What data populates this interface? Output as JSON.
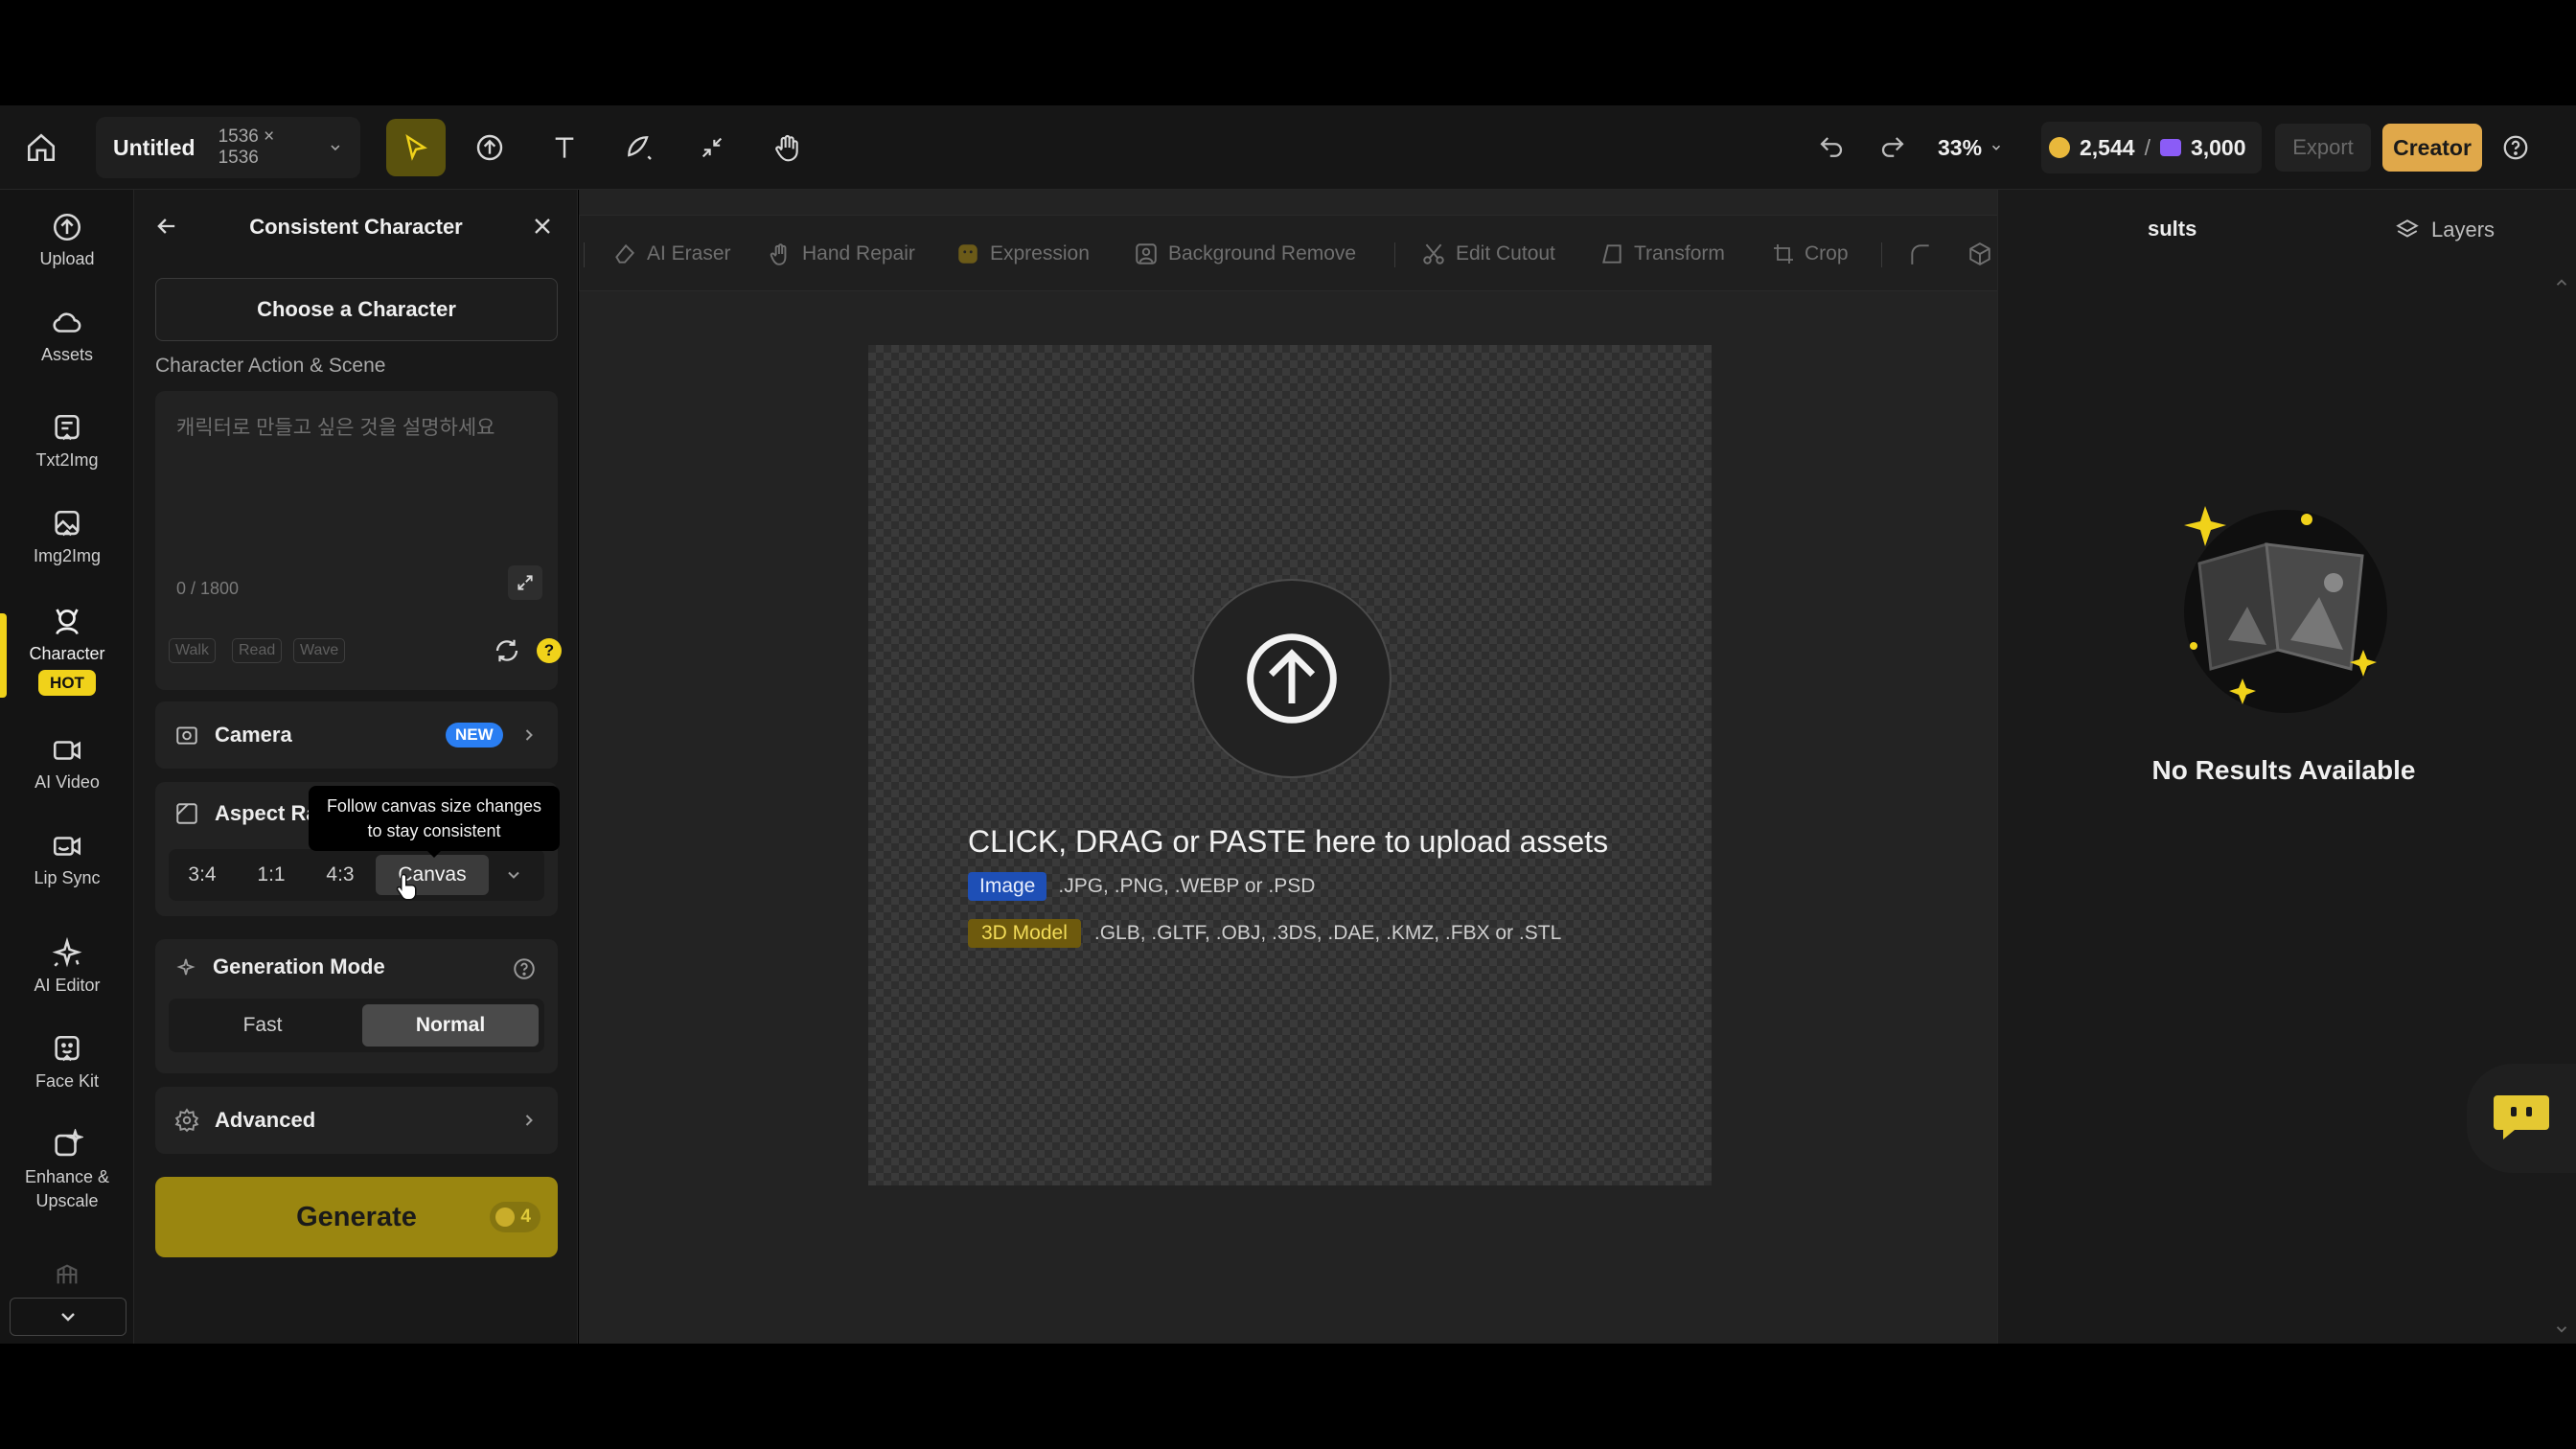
{
  "topbar": {
    "project_name": "Untitled",
    "canvas_size": "1536 × 1536",
    "zoom": "33%",
    "credits": "2,544",
    "credits_separator": "/",
    "premium_credits": "3,000",
    "export_label": "Export",
    "plan_label": "Creator",
    "tools": [
      "select-tool",
      "upload-tool",
      "text-tool",
      "shape-tool",
      "compress-tool",
      "hand-tool"
    ],
    "active_tool": "select-tool"
  },
  "rail": {
    "items": [
      {
        "label": "Upload",
        "icon": "upload-icon"
      },
      {
        "label": "Assets",
        "icon": "cloud-icon"
      },
      {
        "label": "Txt2Img",
        "icon": "txt2img-icon"
      },
      {
        "label": "Img2Img",
        "icon": "img2img-icon"
      },
      {
        "label": "Character",
        "icon": "character-icon",
        "badge": "HOT"
      },
      {
        "label": "AI Video",
        "icon": "video-icon"
      },
      {
        "label": "Lip Sync",
        "icon": "lip-sync-icon"
      },
      {
        "label": "AI Editor",
        "icon": "sparkle-icon"
      },
      {
        "label": "Face Kit",
        "icon": "face-kit-icon"
      },
      {
        "label": "Enhance &",
        "label2": "Upscale",
        "icon": "enhance-icon"
      }
    ],
    "active_item": "Character"
  },
  "panel": {
    "title": "Consistent Character",
    "choose_label": "Choose a Character",
    "scene_label": "Character Action & Scene",
    "scene_placeholder": "캐릭터로 만들고 싶은 것을 설명하세요",
    "scene_count": "0 / 1800",
    "chips": [
      "Walk",
      "Read",
      "Wave"
    ],
    "camera_label": "Camera",
    "camera_badge": "NEW",
    "aspect_label": "Aspect Ra",
    "aspect_options": [
      "3:4",
      "1:1",
      "4:3",
      "Canvas"
    ],
    "aspect_selected": "Canvas",
    "tooltip_line1": "Follow canvas size changes",
    "tooltip_line2": "to stay consistent",
    "mode_label": "Generation Mode",
    "mode_options": [
      "Fast",
      "Normal"
    ],
    "mode_selected": "Normal",
    "advanced_label": "Advanced",
    "generate_label": "Generate",
    "generate_cost": "4"
  },
  "canvas_toolbar": {
    "items": [
      "AI Eraser",
      "Hand Repair",
      "Expression",
      "Background Remove",
      "Edit Cutout",
      "Transform",
      "Crop"
    ]
  },
  "canvas": {
    "upload_title": "CLICK, DRAG or PASTE here to upload assets",
    "image_tag": "Image",
    "image_formats": ".JPG, .PNG, .WEBP or .PSD",
    "model_tag": "3D Model",
    "model_formats": ".GLB, .GLTF, .OBJ, .3DS, .DAE, .KMZ, .FBX or .STL"
  },
  "results": {
    "tab_results": "sults",
    "tab_layers": "Layers",
    "empty_text": "No Results Available"
  },
  "colors": {
    "accent_yellow": "#f0d21a",
    "generate_bg": "#9a8610",
    "creator_bg": "#e0a84a",
    "new_badge": "#2a7ef2",
    "image_tag": "#1e4fb6"
  }
}
